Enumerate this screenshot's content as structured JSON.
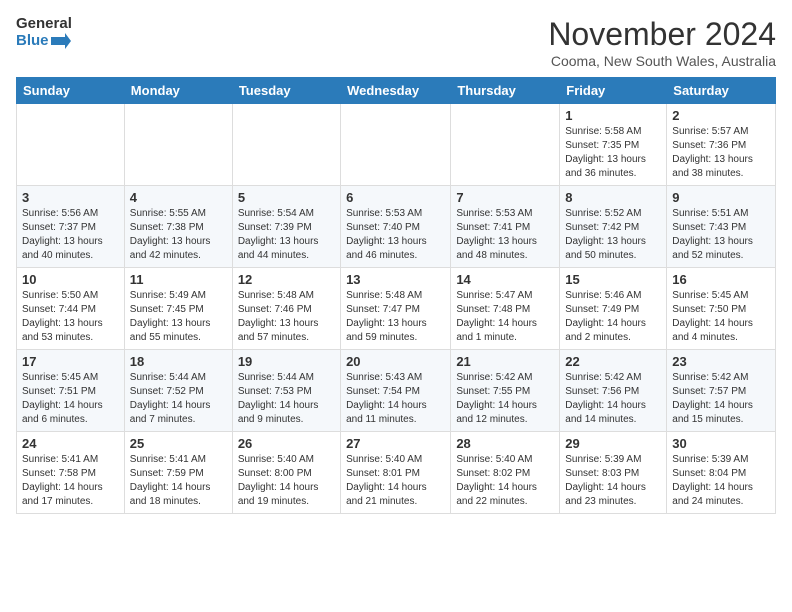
{
  "header": {
    "logo_line1": "General",
    "logo_line2": "Blue",
    "month_title": "November 2024",
    "location": "Cooma, New South Wales, Australia"
  },
  "weekdays": [
    "Sunday",
    "Monday",
    "Tuesday",
    "Wednesday",
    "Thursday",
    "Friday",
    "Saturday"
  ],
  "weeks": [
    [
      {
        "day": "",
        "info": ""
      },
      {
        "day": "",
        "info": ""
      },
      {
        "day": "",
        "info": ""
      },
      {
        "day": "",
        "info": ""
      },
      {
        "day": "",
        "info": ""
      },
      {
        "day": "1",
        "info": "Sunrise: 5:58 AM\nSunset: 7:35 PM\nDaylight: 13 hours\nand 36 minutes."
      },
      {
        "day": "2",
        "info": "Sunrise: 5:57 AM\nSunset: 7:36 PM\nDaylight: 13 hours\nand 38 minutes."
      }
    ],
    [
      {
        "day": "3",
        "info": "Sunrise: 5:56 AM\nSunset: 7:37 PM\nDaylight: 13 hours\nand 40 minutes."
      },
      {
        "day": "4",
        "info": "Sunrise: 5:55 AM\nSunset: 7:38 PM\nDaylight: 13 hours\nand 42 minutes."
      },
      {
        "day": "5",
        "info": "Sunrise: 5:54 AM\nSunset: 7:39 PM\nDaylight: 13 hours\nand 44 minutes."
      },
      {
        "day": "6",
        "info": "Sunrise: 5:53 AM\nSunset: 7:40 PM\nDaylight: 13 hours\nand 46 minutes."
      },
      {
        "day": "7",
        "info": "Sunrise: 5:53 AM\nSunset: 7:41 PM\nDaylight: 13 hours\nand 48 minutes."
      },
      {
        "day": "8",
        "info": "Sunrise: 5:52 AM\nSunset: 7:42 PM\nDaylight: 13 hours\nand 50 minutes."
      },
      {
        "day": "9",
        "info": "Sunrise: 5:51 AM\nSunset: 7:43 PM\nDaylight: 13 hours\nand 52 minutes."
      }
    ],
    [
      {
        "day": "10",
        "info": "Sunrise: 5:50 AM\nSunset: 7:44 PM\nDaylight: 13 hours\nand 53 minutes."
      },
      {
        "day": "11",
        "info": "Sunrise: 5:49 AM\nSunset: 7:45 PM\nDaylight: 13 hours\nand 55 minutes."
      },
      {
        "day": "12",
        "info": "Sunrise: 5:48 AM\nSunset: 7:46 PM\nDaylight: 13 hours\nand 57 minutes."
      },
      {
        "day": "13",
        "info": "Sunrise: 5:48 AM\nSunset: 7:47 PM\nDaylight: 13 hours\nand 59 minutes."
      },
      {
        "day": "14",
        "info": "Sunrise: 5:47 AM\nSunset: 7:48 PM\nDaylight: 14 hours\nand 1 minute."
      },
      {
        "day": "15",
        "info": "Sunrise: 5:46 AM\nSunset: 7:49 PM\nDaylight: 14 hours\nand 2 minutes."
      },
      {
        "day": "16",
        "info": "Sunrise: 5:45 AM\nSunset: 7:50 PM\nDaylight: 14 hours\nand 4 minutes."
      }
    ],
    [
      {
        "day": "17",
        "info": "Sunrise: 5:45 AM\nSunset: 7:51 PM\nDaylight: 14 hours\nand 6 minutes."
      },
      {
        "day": "18",
        "info": "Sunrise: 5:44 AM\nSunset: 7:52 PM\nDaylight: 14 hours\nand 7 minutes."
      },
      {
        "day": "19",
        "info": "Sunrise: 5:44 AM\nSunset: 7:53 PM\nDaylight: 14 hours\nand 9 minutes."
      },
      {
        "day": "20",
        "info": "Sunrise: 5:43 AM\nSunset: 7:54 PM\nDaylight: 14 hours\nand 11 minutes."
      },
      {
        "day": "21",
        "info": "Sunrise: 5:42 AM\nSunset: 7:55 PM\nDaylight: 14 hours\nand 12 minutes."
      },
      {
        "day": "22",
        "info": "Sunrise: 5:42 AM\nSunset: 7:56 PM\nDaylight: 14 hours\nand 14 minutes."
      },
      {
        "day": "23",
        "info": "Sunrise: 5:42 AM\nSunset: 7:57 PM\nDaylight: 14 hours\nand 15 minutes."
      }
    ],
    [
      {
        "day": "24",
        "info": "Sunrise: 5:41 AM\nSunset: 7:58 PM\nDaylight: 14 hours\nand 17 minutes."
      },
      {
        "day": "25",
        "info": "Sunrise: 5:41 AM\nSunset: 7:59 PM\nDaylight: 14 hours\nand 18 minutes."
      },
      {
        "day": "26",
        "info": "Sunrise: 5:40 AM\nSunset: 8:00 PM\nDaylight: 14 hours\nand 19 minutes."
      },
      {
        "day": "27",
        "info": "Sunrise: 5:40 AM\nSunset: 8:01 PM\nDaylight: 14 hours\nand 21 minutes."
      },
      {
        "day": "28",
        "info": "Sunrise: 5:40 AM\nSunset: 8:02 PM\nDaylight: 14 hours\nand 22 minutes."
      },
      {
        "day": "29",
        "info": "Sunrise: 5:39 AM\nSunset: 8:03 PM\nDaylight: 14 hours\nand 23 minutes."
      },
      {
        "day": "30",
        "info": "Sunrise: 5:39 AM\nSunset: 8:04 PM\nDaylight: 14 hours\nand 24 minutes."
      }
    ]
  ]
}
